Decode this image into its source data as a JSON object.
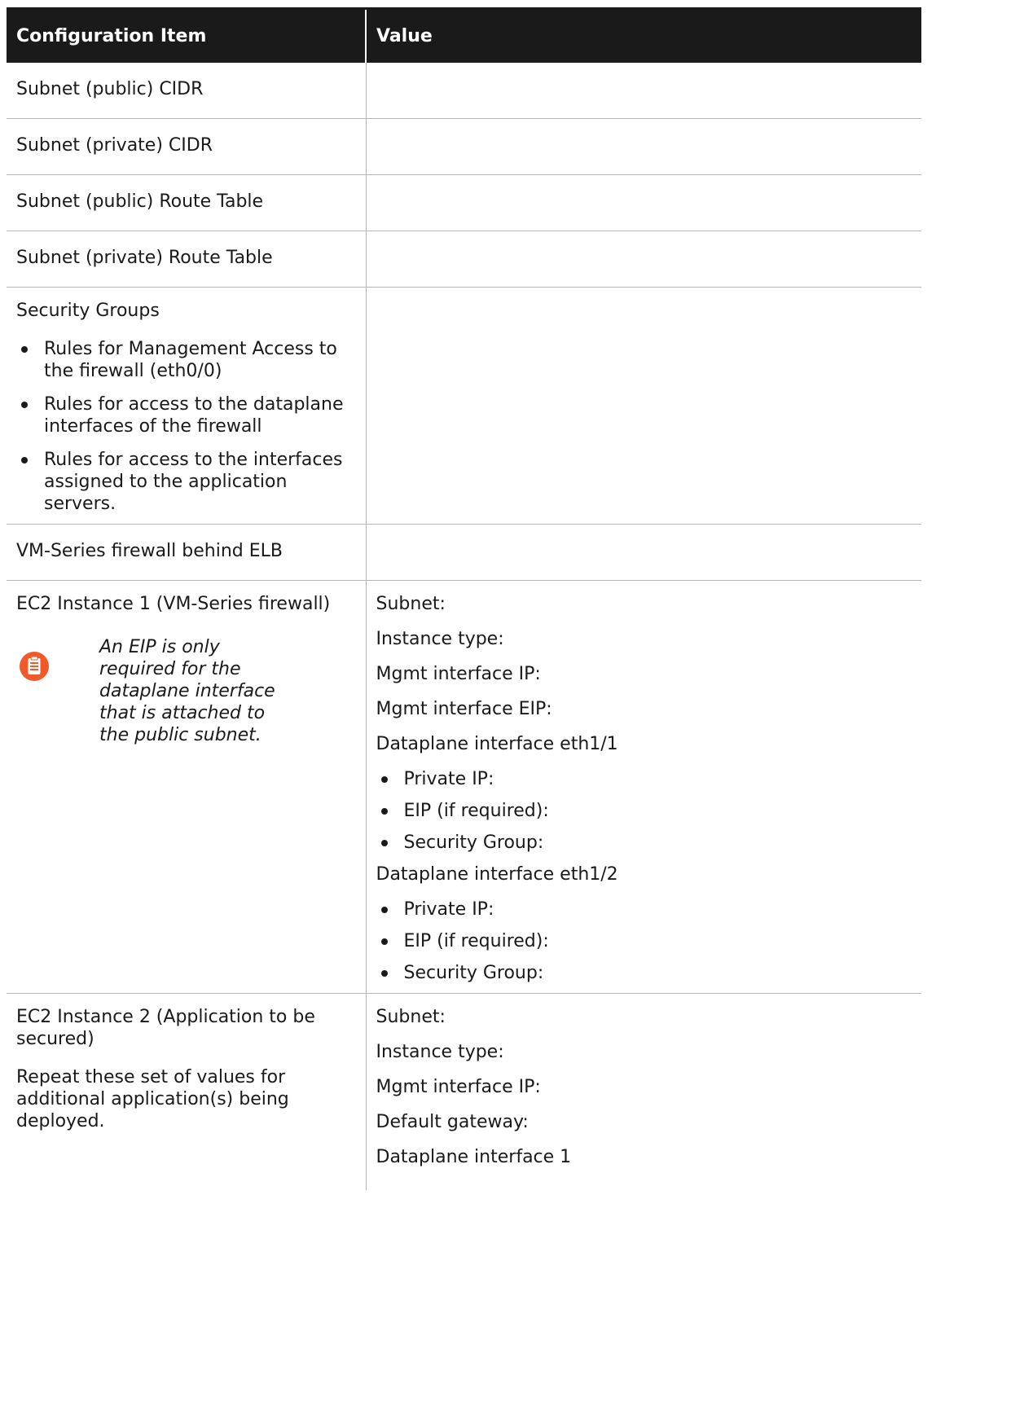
{
  "table": {
    "headers": [
      "Configuration Item",
      "Value"
    ],
    "rows": {
      "subnet_public_cidr": "Subnet (public) CIDR",
      "subnet_private_cidr": "Subnet (private) CIDR",
      "subnet_public_route": "Subnet (public) Route Table",
      "subnet_private_route": "Subnet (private) Route Table",
      "security_groups": {
        "title": "Security Groups",
        "bullets": [
          "Rules for Management Access to the firewall (eth0/0)",
          "Rules for access to the dataplane interfaces of the firewall",
          "Rules for access to the interfaces assigned to the application servers."
        ]
      },
      "vm_behind_elb": "VM-Series firewall behind ELB",
      "ec2_instance_1": {
        "title": "EC2 Instance 1 (VM-Series firewall)",
        "note": "An EIP is only required for the dataplane interface that is attached to the public subnet.",
        "note_icon": "note-icon",
        "note_icon_color": "#f05a28",
        "values": {
          "subnet": "Subnet:",
          "instance_type": "Instance type:",
          "mgmt_ip": "Mgmt interface IP:",
          "mgmt_eip": "Mgmt interface EIP:",
          "eth1_1_title": "Dataplane interface eth1/1",
          "eth1_1_items": [
            "Private IP:",
            "EIP (if required):",
            "Security Group:"
          ],
          "eth1_2_title": "Dataplane interface eth1/2",
          "eth1_2_items": [
            "Private IP:",
            "EIP (if required):",
            "Security Group:"
          ]
        }
      },
      "ec2_instance_2": {
        "title": "EC2 Instance 2 (Application to be secured)",
        "description": "Repeat these set of values for additional application(s) being deployed.",
        "values": {
          "subnet": "Subnet:",
          "instance_type": "Instance type:",
          "mgmt_ip": "Mgmt interface IP:",
          "default_gateway": "Default gateway:",
          "dataplane_1": "Dataplane interface 1"
        }
      }
    }
  }
}
